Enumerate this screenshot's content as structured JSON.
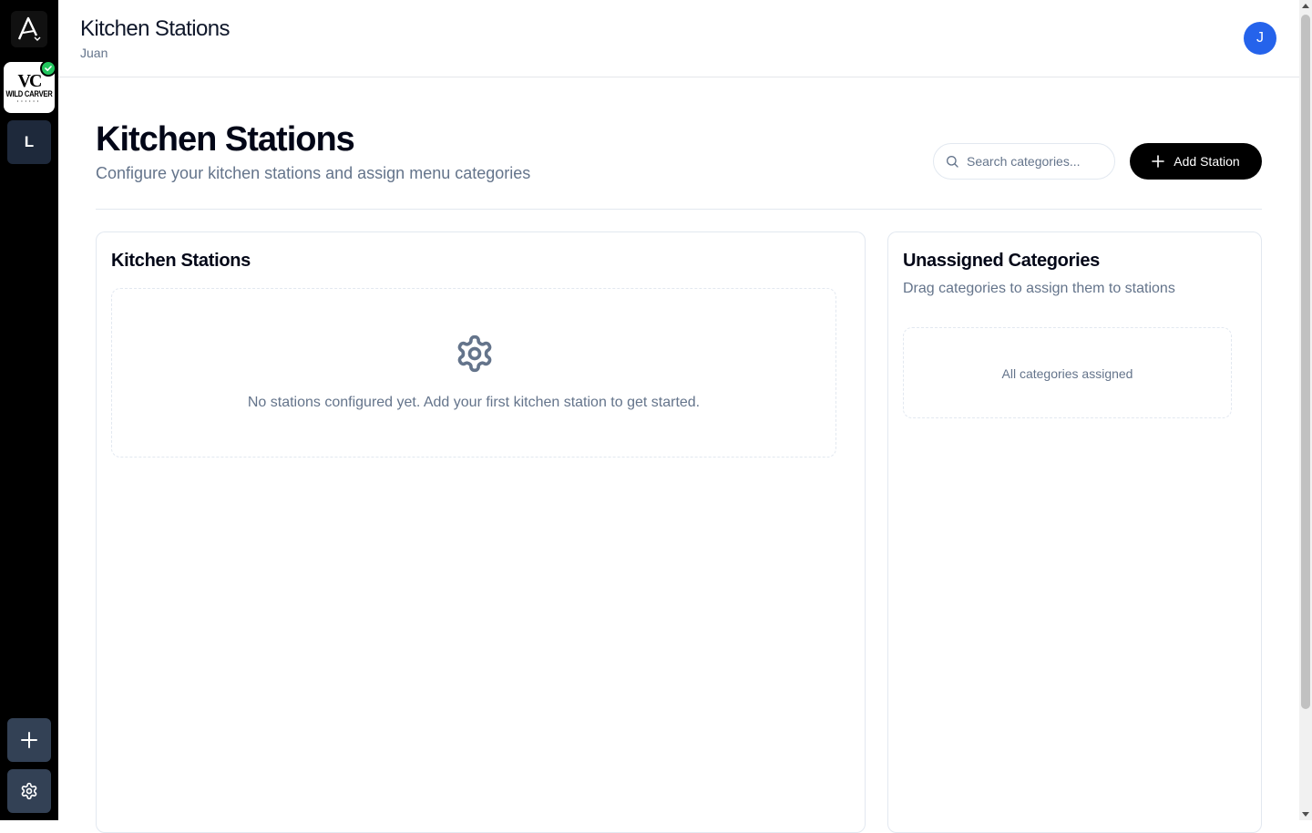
{
  "sidebar": {
    "brand_logo_text": "VC",
    "brand_logo_subtext": "WILD CARVER",
    "workspace_initial": "L",
    "icons": {
      "app_logo": "app-logo-icon",
      "check": "check-icon",
      "add": "plus-icon",
      "settings": "gear-icon"
    }
  },
  "header": {
    "title": "Kitchen Stations",
    "subtitle": "Juan",
    "avatar_initial": "J"
  },
  "page": {
    "title": "Kitchen Stations",
    "subtitle": "Configure your kitchen stations and assign menu categories",
    "search": {
      "placeholder": "Search categories...",
      "value": ""
    },
    "add_button_label": "Add Station"
  },
  "stations_panel": {
    "title": "Kitchen Stations",
    "empty_message": "No stations configured yet. Add your first kitchen station to get started."
  },
  "unassigned_panel": {
    "title": "Unassigned Categories",
    "description": "Drag categories to assign them to stations",
    "empty_message": "All categories assigned"
  },
  "colors": {
    "accent": "#2563eb",
    "success": "#22c55e",
    "primary_button": "#000000",
    "muted_text": "#64748b"
  }
}
